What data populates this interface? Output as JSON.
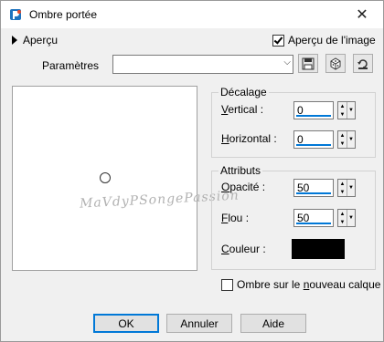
{
  "window": {
    "title": "Ombre portée"
  },
  "preview_toggle": {
    "label": "Aperçu"
  },
  "image_preview": {
    "label": "Aperçu de l'image",
    "checked": true
  },
  "params": {
    "label": "Paramètres",
    "value": ""
  },
  "offset_group": {
    "title": "Décalage",
    "vertical": {
      "label_u": "V",
      "label_rest": "ertical :",
      "value": "0"
    },
    "horizontal": {
      "label_u": "H",
      "label_rest": "orizontal :",
      "value": "0"
    }
  },
  "attributes_group": {
    "title": "Attributs",
    "opacity": {
      "label_u": "O",
      "label_rest": "pacité :",
      "value": "50"
    },
    "blur": {
      "label_u": "F",
      "label_rest": "lou :",
      "value": "50"
    },
    "color": {
      "label_u": "C",
      "label_rest": "ouleur :",
      "hex": "#000000"
    }
  },
  "shadow_new_layer": {
    "label_pre": "Ombre sur le ",
    "label_u": "n",
    "label_post": "ouveau calque",
    "checked": false
  },
  "watermark": "MaVdyPSongePassion",
  "buttons": {
    "ok": "OK",
    "cancel": "Annuler",
    "help": "Aide"
  }
}
